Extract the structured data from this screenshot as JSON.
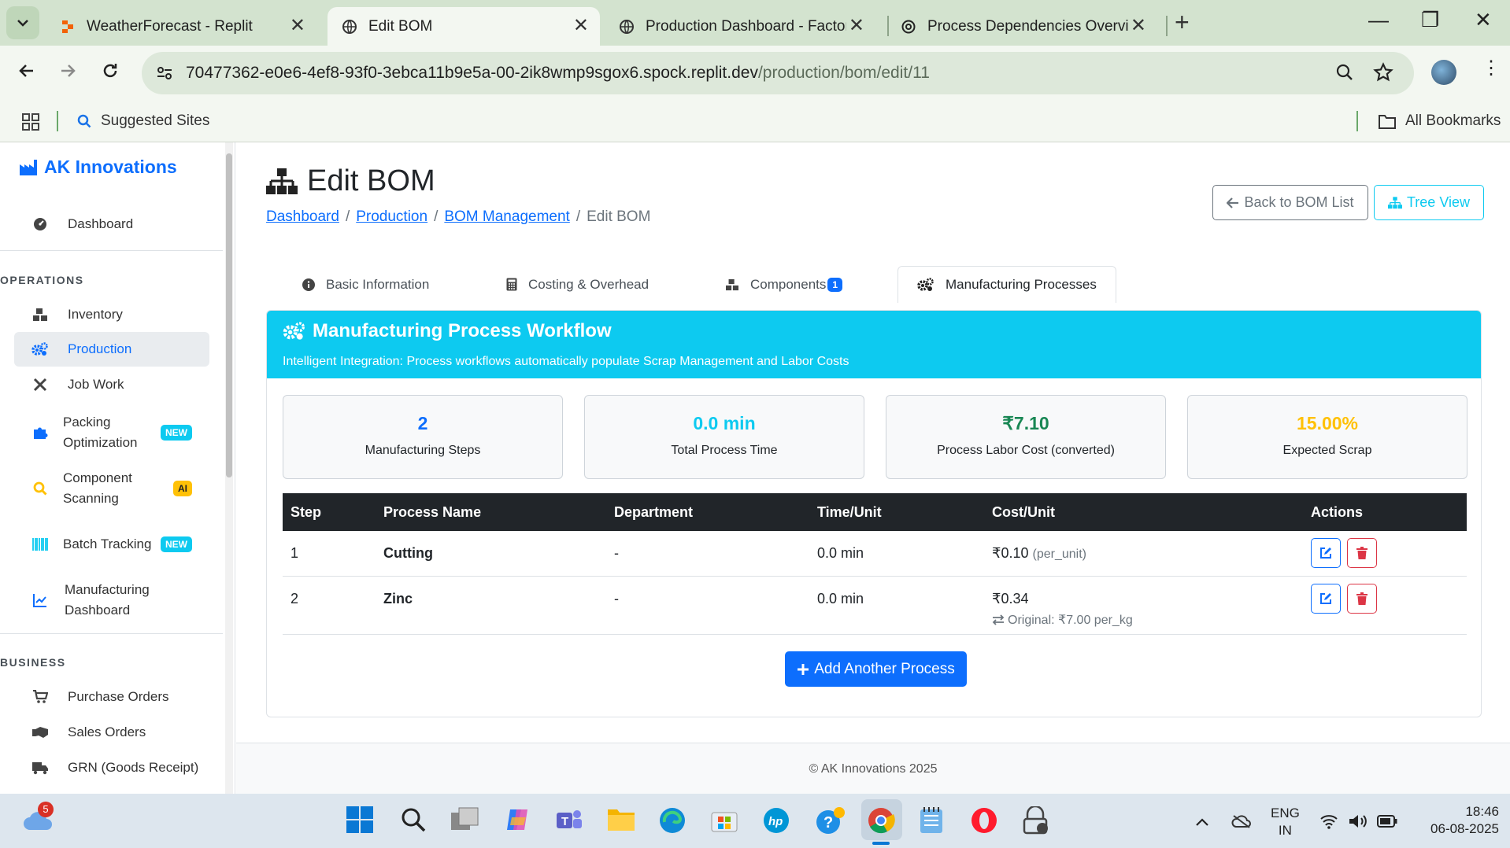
{
  "browser": {
    "tabs": [
      {
        "title": "WeatherForecast - Replit",
        "icon": "replit-icon"
      },
      {
        "title": "Edit BOM",
        "icon": "globe-icon",
        "active": true
      },
      {
        "title": "Production Dashboard - Factory",
        "icon": "globe-icon"
      },
      {
        "title": "Process Dependencies Overview",
        "icon": "openai-icon"
      }
    ],
    "url_host": "70477362-e0e6-4ef8-93f0-3ebca11b9e5a-00-2ik8wmp9sgox6.spock.replit.dev",
    "url_path": "/production/bom/edit/11",
    "bookmarks": {
      "suggested": "Suggested Sites",
      "all": "All Bookmarks"
    }
  },
  "sidebar": {
    "brand": "AK Innovations",
    "dashboard": "Dashboard",
    "operations_heading": "OPERATIONS",
    "operations": [
      {
        "label": "Inventory",
        "icon": "boxes-icon"
      },
      {
        "label": "Production",
        "icon": "cogs-icon",
        "active": true
      },
      {
        "label": "Job Work",
        "icon": "tools-icon"
      },
      {
        "label": "Packing Optimization",
        "icon": "puzzle-icon",
        "badge": "NEW"
      },
      {
        "label": "Component Scanning",
        "icon": "search-icon",
        "badge": "AI"
      },
      {
        "label": "Batch Tracking",
        "icon": "barcode-icon",
        "badge": "NEW"
      },
      {
        "label": "Manufacturing Dashboard",
        "icon": "chart-line-icon"
      }
    ],
    "business_heading": "BUSINESS",
    "business": [
      {
        "label": "Purchase Orders",
        "icon": "cart-icon"
      },
      {
        "label": "Sales Orders",
        "icon": "handshake-icon"
      },
      {
        "label": "GRN (Goods Receipt)",
        "icon": "truck-icon"
      }
    ]
  },
  "page": {
    "title": "Edit BOM",
    "breadcrumb": {
      "dashboard": "Dashboard",
      "production": "Production",
      "bom": "BOM Management",
      "current": "Edit BOM",
      "sep": "/"
    },
    "back_button": "Back to BOM List",
    "tree_button": "Tree View",
    "tabs": {
      "basic": "Basic Information",
      "costing": "Costing & Overhead",
      "components": "Components",
      "components_count": "1",
      "processes": "Manufacturing Processes"
    }
  },
  "workflow": {
    "title": "Manufacturing Process Workflow",
    "subtitle": "Intelligent Integration: Process workflows automatically populate Scrap Management and Labor Costs",
    "stats": [
      {
        "value": "2",
        "label": "Manufacturing Steps",
        "color": "#0d6efd"
      },
      {
        "value": "0.0 min",
        "label": "Total Process Time",
        "color": "#0dcaf0"
      },
      {
        "value": "₹7.10",
        "label": "Process Labor Cost (converted)",
        "color": "#198754"
      },
      {
        "value": "15.00%",
        "label": "Expected Scrap",
        "color": "#ffc107"
      }
    ],
    "columns": [
      "Step",
      "Process Name",
      "Department",
      "Time/Unit",
      "Cost/Unit",
      "Actions"
    ],
    "rows": [
      {
        "step": "1",
        "name": "Cutting",
        "department": "-",
        "time": "0.0 min",
        "cost": "₹0.10",
        "cost_unit": "(per_unit)",
        "original": ""
      },
      {
        "step": "2",
        "name": "Zinc",
        "department": "-",
        "time": "0.0 min",
        "cost": "₹0.34",
        "cost_unit": "",
        "original": "Original: ₹7.00 per_kg"
      }
    ],
    "add_button": "Add Another Process"
  },
  "footer": "© AK Innovations 2025",
  "taskbar": {
    "weather_badge": "5",
    "lang": "ENG",
    "region": "IN",
    "time": "18:46",
    "date": "06-08-2025"
  }
}
